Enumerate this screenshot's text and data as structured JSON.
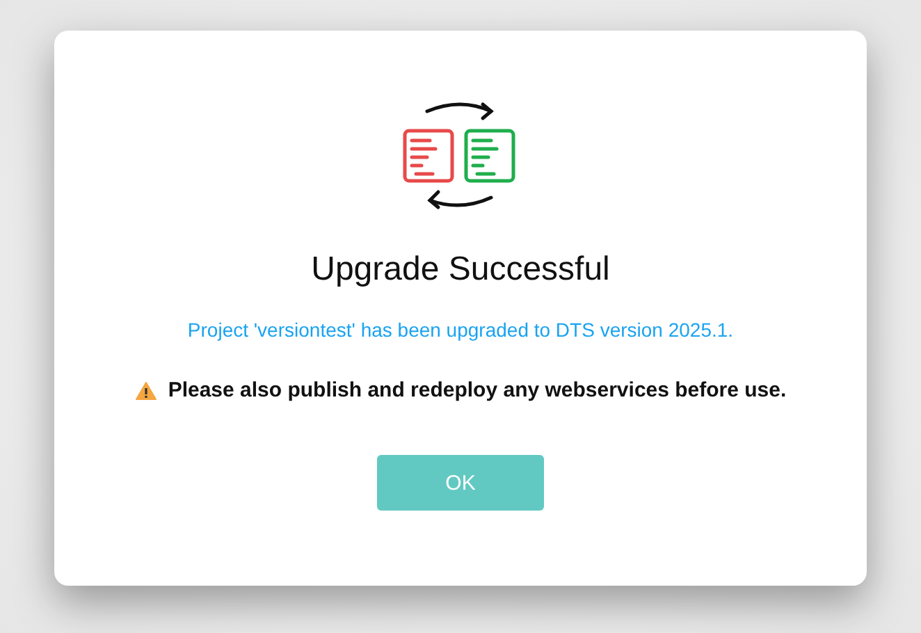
{
  "dialog": {
    "title": "Upgrade Successful",
    "message": "Project 'versiontest' has been upgraded to DTS version 2025.1.",
    "warning": "Please also publish and redeploy any webservices before use.",
    "buttons": [
      "OK"
    ]
  }
}
